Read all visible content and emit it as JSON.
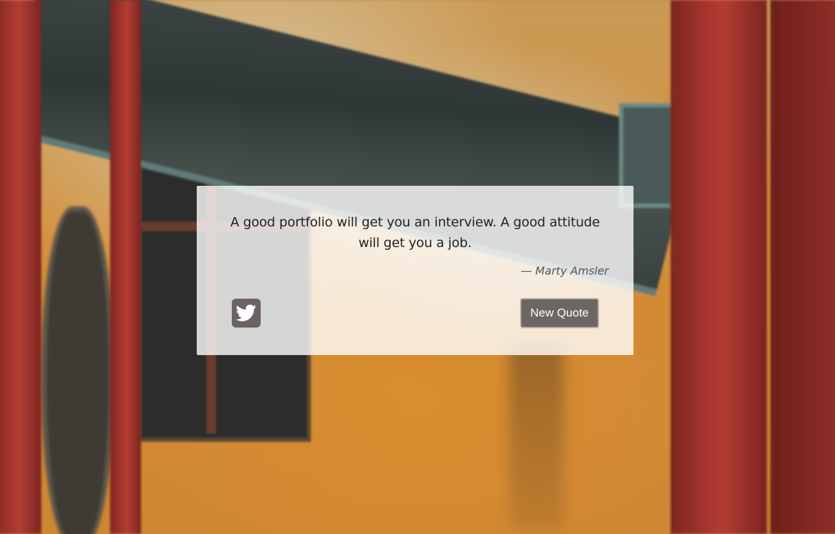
{
  "quote": {
    "text": "A good portfolio will get you an interview. A good attitude will get you a job.",
    "author": "— Marty Amsler"
  },
  "actions": {
    "tweet_icon": "twitter-icon",
    "new_quote_label": "New Quote"
  },
  "colors": {
    "card_background": "#ffffff",
    "button_background": "#6d6663",
    "text": "#222222"
  }
}
